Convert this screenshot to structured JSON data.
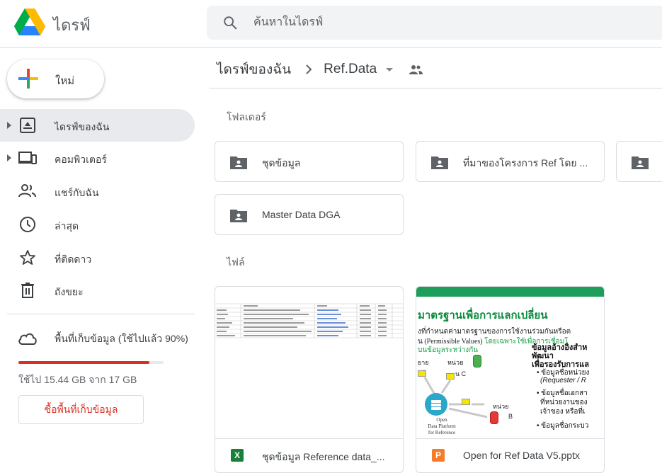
{
  "app": {
    "title": "ไดรฟ์"
  },
  "search": {
    "placeholder": "ค้นหาในไดรฟ์"
  },
  "sidebar": {
    "new_label": "ใหม่",
    "items": [
      {
        "label": "ไดรฟ์ของฉัน",
        "icon": "my-drive-icon",
        "expandable": true,
        "active": true
      },
      {
        "label": "คอมพิวเตอร์",
        "icon": "computers-icon",
        "expandable": true,
        "active": false
      },
      {
        "label": "แชร์กับฉัน",
        "icon": "shared-with-me-icon",
        "expandable": false,
        "active": false
      },
      {
        "label": "ล่าสุด",
        "icon": "recent-clock-icon",
        "expandable": false,
        "active": false
      },
      {
        "label": "ที่ติดดาว",
        "icon": "star-icon",
        "expandable": false,
        "active": false
      },
      {
        "label": "ถังขยะ",
        "icon": "trash-icon",
        "expandable": false,
        "active": false
      }
    ],
    "storage": {
      "label": "พื้นที่เก็บข้อมูล (ใช้ไปแล้ว 90%)",
      "used_fraction": 0.9,
      "usage_text": "ใช้ไป 15.44 GB จาก 17 GB",
      "buy_label": "ซื้อพื้นที่เก็บข้อมูล"
    }
  },
  "breadcrumb": {
    "root": "ไดรฟ์ของฉัน",
    "current": "Ref.Data"
  },
  "sections": {
    "folders_label": "โฟลเดอร์",
    "files_label": "ไฟล์"
  },
  "folders": [
    {
      "name": "ชุดข้อมูล"
    },
    {
      "name": "ที่มาของโครงการ Ref โดย ..."
    },
    {
      "name": ""
    },
    {
      "name": "Master Data DGA"
    }
  ],
  "files": [
    {
      "name": "ชุดข้อมูล Reference data_...",
      "type_letter": "X",
      "type_color": "#188038"
    },
    {
      "name": "Open for Ref Data V5.pptx",
      "type_letter": "P",
      "type_color": "#f57c2b"
    }
  ],
  "slide": {
    "title": "มาตรฐานเพื่อการแลกเปลี่ยน",
    "line1": "งที่กำหนดค่ามาตรฐานของการใช้งานร่วมกันหรือต",
    "line2a": "น (Permissible Values)",
    "line2b": "โดยเฉพาะใช้เพื่อการเชื่อมโ",
    "line3": "บนข้อมูลระหว่างกัน",
    "right1": "ข้อมูลอ้างอิงสำห",
    "right2": "พัฒนา",
    "right3": "เพื่อรองรับการแล",
    "right4": "• ข้อมูลชื่อหน่วยง",
    "right5": "(Requester / R",
    "right6": "• ข้อมูลชื่อเอกสา",
    "right7": "ที่หน่วยงานของ",
    "right8": "เจ้าของ หรือที่เ",
    "right9": "• ข้อมูลชื่อกระบว",
    "node_a": "ยาย",
    "node_a2": "A",
    "node_unit": "หน่วย",
    "node_c": "น C",
    "node_b_label": "หน่วย",
    "node_b": "B",
    "platform1": "Open",
    "platform2": "Data Platform",
    "platform3": "for Reference"
  }
}
